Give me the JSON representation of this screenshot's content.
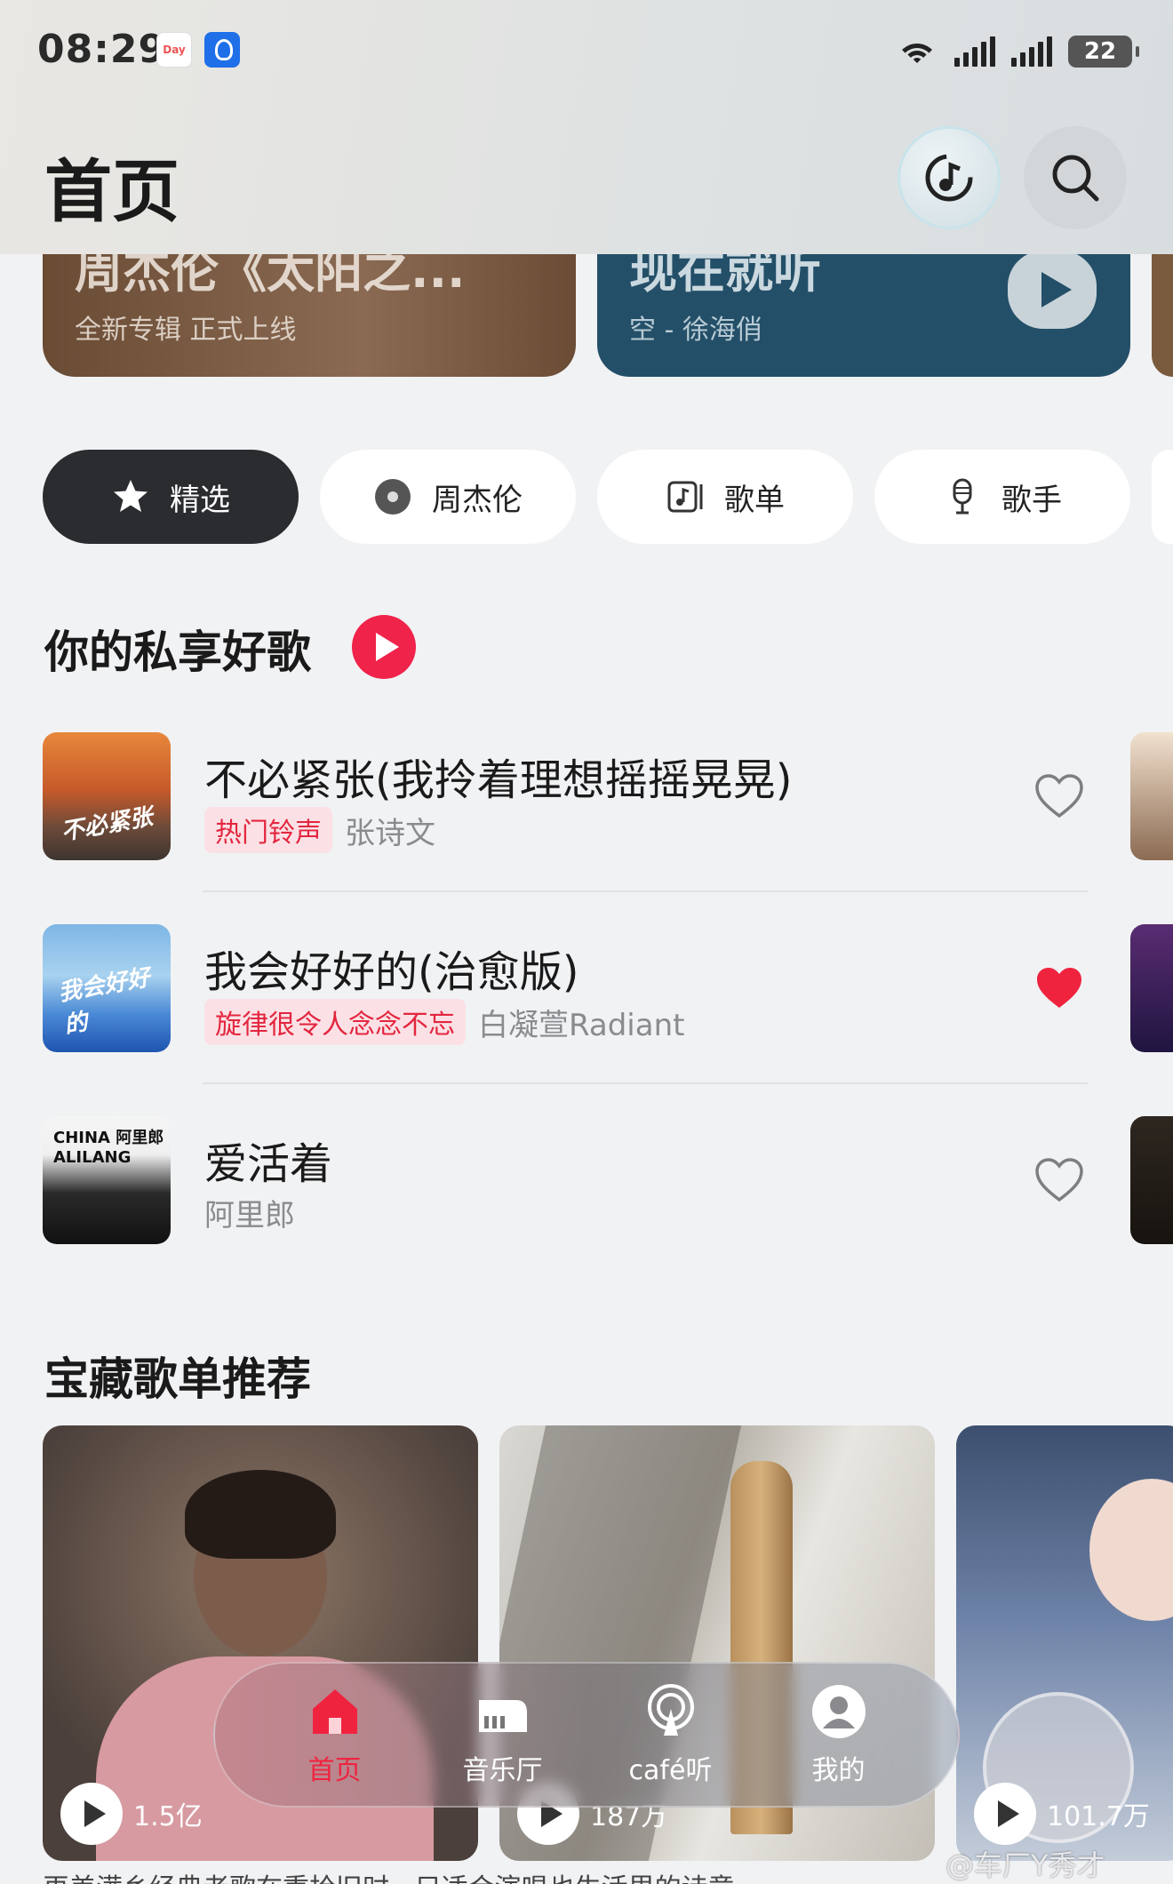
{
  "status_bar": {
    "time": "08:29",
    "day_badge": "Day",
    "battery": "22"
  },
  "header": {
    "title": "首页",
    "recognize_icon": "music-recognition-icon",
    "search_icon": "search-icon"
  },
  "banners": [
    {
      "title": "周杰伦《太阳之...",
      "subtitle": "全新专辑 正式上线"
    },
    {
      "title": "现在就听",
      "subtitle": "空 - 徐海俏"
    }
  ],
  "chips": [
    {
      "label": "精选",
      "icon": "star-icon",
      "selected": true
    },
    {
      "label": "周杰伦",
      "icon": "artist-vinyl-icon",
      "selected": false
    },
    {
      "label": "歌单",
      "icon": "playlist-icon",
      "selected": false
    },
    {
      "label": "歌手",
      "icon": "microphone-icon",
      "selected": false
    }
  ],
  "private_songs": {
    "title": "你的私享好歌",
    "items": [
      {
        "title": "不必紧张(我拎着理想摇摇晃晃)",
        "tag": "热门铃声",
        "artist": "张诗文",
        "liked": false,
        "cover_text": "不必紧张"
      },
      {
        "title": "我会好好的(治愈版)",
        "tag": "旋律很令人念念不忘",
        "artist": "白凝萱Radiant",
        "liked": true,
        "cover_text": "我会好好的"
      },
      {
        "title": "爱活着",
        "tag": "",
        "artist": "阿里郎",
        "liked": false,
        "cover_text": "CHINA 阿里郎 ALILANG"
      }
    ]
  },
  "playlists": {
    "title": "宝藏歌单推荐",
    "items": [
      {
        "plays": "1.5亿"
      },
      {
        "plays": "187万"
      },
      {
        "plays": "101.7万"
      }
    ],
    "desc_row": "再美满乡经典老歌在重拾旧时 · 只适合演唱也生活里的诗意"
  },
  "bottom_nav": [
    {
      "label": "首页",
      "icon": "home-icon",
      "active": true
    },
    {
      "label": "音乐厅",
      "icon": "piano-icon",
      "active": false
    },
    {
      "label": "café听",
      "icon": "podcast-icon",
      "active": false
    },
    {
      "label": "我的",
      "icon": "profile-icon",
      "active": false
    }
  ],
  "watermark": "@车厂Y秀才",
  "colors": {
    "accent": "#f0233f",
    "chip_selected": "#2b2c30",
    "tag_bg": "#fbe1e5"
  }
}
